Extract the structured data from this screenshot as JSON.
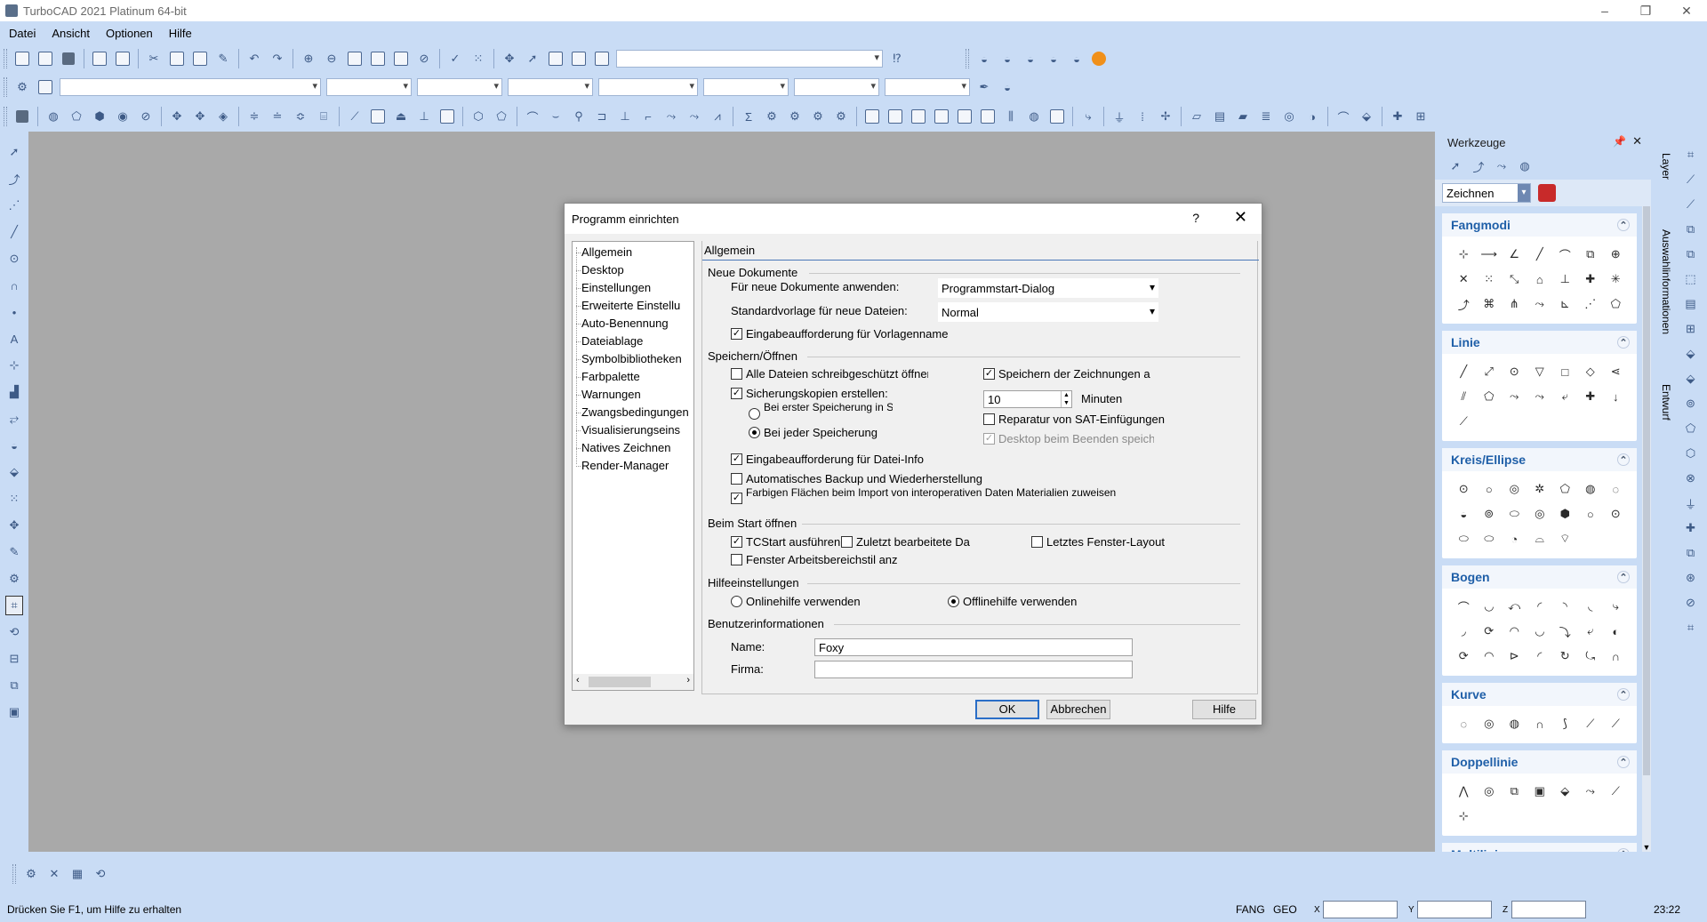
{
  "window": {
    "title": "TurboCAD 2021 Platinum 64-bit",
    "minimize": "–",
    "restore": "❐",
    "close": "✕"
  },
  "menu": [
    "Datei",
    "Ansicht",
    "Optionen",
    "Hilfe"
  ],
  "panel": {
    "title": "Werkzeuge",
    "pin": "📌",
    "close": "✕",
    "mode": "Zeichnen",
    "groups": [
      {
        "title": "Fangmodi",
        "count": 21
      },
      {
        "title": "Linie",
        "count": 15
      },
      {
        "title": "Kreis/Ellipse",
        "count": 19
      },
      {
        "title": "Bogen",
        "count": 21
      },
      {
        "title": "Kurve",
        "count": 7
      },
      {
        "title": "Doppellinie",
        "count": 8
      },
      {
        "title": "Multilinie",
        "count": 0
      }
    ]
  },
  "side_tabs": [
    "Layer",
    "Auswahlinformationen",
    "Entwurf"
  ],
  "status": {
    "hint": "Drücken Sie F1, um Hilfe zu erhalten",
    "fang": "FANG",
    "geo": "GEO",
    "x_label": "X",
    "y_label": "Y",
    "z_label": "Z",
    "time": "23:22"
  },
  "dialog": {
    "title": "Programm einrichten",
    "help_q": "?",
    "close": "✕",
    "tree": [
      "Allgemein",
      "Desktop",
      "Einstellungen",
      "Erweiterte Einstellu",
      "Auto-Benennung",
      "Dateiablage",
      "Symbolbibliotheken",
      "Farbpalette",
      "Warnungen",
      "Zwangsbedingungen",
      "Visualisierungseins",
      "Natives Zeichnen",
      "Render-Manager"
    ],
    "page_title": "Allgemein",
    "neue_dokumente": {
      "section": "Neue Dokumente",
      "fuer_neue_label": "Für neue Dokumente anwenden:",
      "fuer_neue_value": "Programmstart-Dialog",
      "vorlage_label": "Standardvorlage für neue Dateien:",
      "vorlage_value": "Normal",
      "eingabe_vorlage": "Eingabeaufforderung für Vorlagenname"
    },
    "speichern": {
      "section": "Speichern/Öffnen",
      "alle_dateien": "Alle Dateien schreibgeschützt öffnen",
      "speichern_zeichnungen": "Speichern der Zeichnungen a",
      "sicherungskopien": "Sicherungskopien erstellen:",
      "minuten_value": "10",
      "minuten_label": "Minuten",
      "erster_speicherung": "Bei erster Speicherung in Sitzung",
      "jeder_speicherung": "Bei jeder Speicherung",
      "reparatur": "Reparatur von SAT-Einfügungen",
      "desktop_beenden": "Desktop beim Beenden speicher",
      "eingabe_datei_info": "Eingabeaufforderung für Datei-Info",
      "auto_backup": "Automatisches Backup und Wiederherstellung",
      "farbigen_flaechen": "Farbigen Flächen beim Import von interoperativen Daten Materialien zuweisen"
    },
    "start": {
      "section": "Beim Start öffnen",
      "tcstart": "TCStart ausführen",
      "zuletzt": "Zuletzt bearbeitete Da",
      "letztes_layout": "Letztes Fenster-Layout",
      "fenster_arbeitsbereich": "Fenster Arbeitsbereichstil anz"
    },
    "hilfe": {
      "section": "Hilfeeinstellungen",
      "online": "Onlinehilfe verwenden",
      "offline": "Offlinehilfe verwenden"
    },
    "benutzer": {
      "section": "Benutzerinformationen",
      "name_label": "Name:",
      "name_value": "Foxy",
      "firma_label": "Firma:",
      "firma_value": ""
    },
    "buttons": {
      "ok": "OK",
      "cancel": "Abbrechen",
      "help": "Hilfe"
    }
  }
}
